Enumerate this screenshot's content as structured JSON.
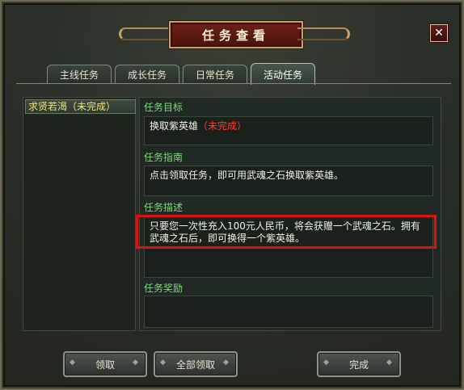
{
  "window": {
    "title": "任务查看",
    "close_label": "✕"
  },
  "tabs": [
    {
      "label": "主线任务",
      "active": false
    },
    {
      "label": "成长任务",
      "active": false
    },
    {
      "label": "日常任务",
      "active": false
    },
    {
      "label": "活动任务",
      "active": true
    }
  ],
  "quest_list": [
    {
      "label": "求贤若渴（未完成）",
      "selected": true
    }
  ],
  "details": {
    "goal_label": "任务目标",
    "goal_text": "换取紫英雄",
    "goal_status": "（未完成）",
    "guide_label": "任务指南",
    "guide_text": "点击领取任务，即可用武魂之石换取紫英雄。",
    "desc_label": "任务描述",
    "desc_text": "只要您一次性充入100元人民币，将会获赠一个武魂之石。拥有武魂之石后，即可换得一个紫英雄。",
    "reward_label": "任务奖励",
    "reward_text": ""
  },
  "buttons": {
    "accept": "领取",
    "accept_all": "全部领取",
    "complete": "完成"
  },
  "colors": {
    "frame": "#2b2f29",
    "title_plate": "#6e2218",
    "section_label": "#7fd77a",
    "status_red": "#ff3c2c",
    "highlight": "#d81414"
  }
}
